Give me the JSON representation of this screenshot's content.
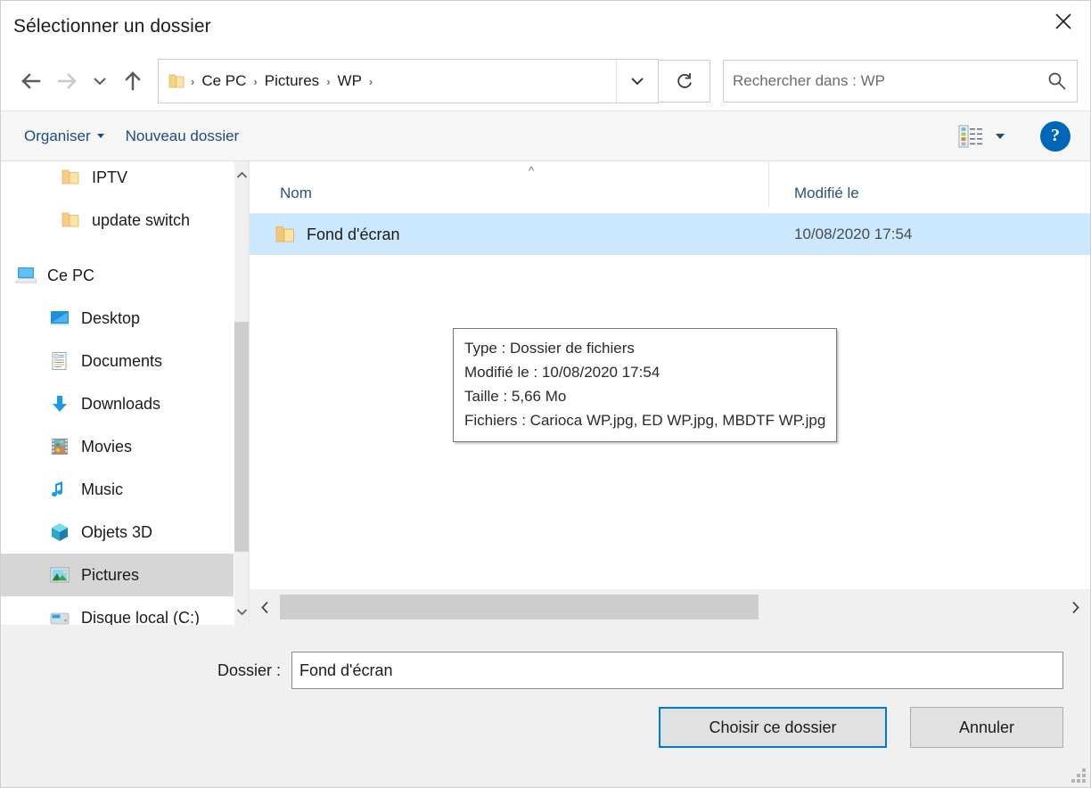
{
  "window": {
    "title": "Sélectionner un dossier",
    "close_label": "×",
    "close_icon": "close-icon"
  },
  "addressbar": {
    "back_icon": "arrow-left-icon",
    "forward_icon": "arrow-right-icon",
    "recent_icon": "chevron-down-icon",
    "up_icon": "arrow-up-icon",
    "folder_icon": "folder-icon",
    "crumb_separator": "›",
    "breadcrumbs": [
      {
        "label": "Ce PC"
      },
      {
        "label": "Pictures"
      },
      {
        "label": "WP"
      }
    ],
    "dropdown_icon": "chevron-down-icon",
    "refresh_icon": "refresh-icon",
    "refresh_label": "↻"
  },
  "search": {
    "value": "",
    "placeholder": "Rechercher dans : WP",
    "icon": "search-icon"
  },
  "toolbar": {
    "organize_label": "Organiser",
    "new_folder_label": "Nouveau dossier",
    "view_icon": "view-list-icon",
    "view_caret_icon": "chevron-down-icon",
    "help_label": "?",
    "help_icon": "help-icon"
  },
  "sidebar": {
    "items": [
      {
        "label": "IPTV",
        "icon": "folder-icon",
        "indent": 2,
        "selected": false
      },
      {
        "label": "update switch",
        "icon": "folder-icon",
        "indent": 2,
        "selected": false
      },
      {
        "label": "Ce PC",
        "icon": "this-pc-icon",
        "indent": 0,
        "selected": false
      },
      {
        "label": "Desktop",
        "icon": "desktop-icon",
        "indent": 1,
        "selected": false
      },
      {
        "label": "Documents",
        "icon": "documents-icon",
        "indent": 1,
        "selected": false
      },
      {
        "label": "Downloads",
        "icon": "downloads-icon",
        "indent": 1,
        "selected": false
      },
      {
        "label": "Movies",
        "icon": "movies-icon",
        "indent": 1,
        "selected": false
      },
      {
        "label": "Music",
        "icon": "music-icon",
        "indent": 1,
        "selected": false
      },
      {
        "label": "Objets 3D",
        "icon": "objects3d-icon",
        "indent": 1,
        "selected": false
      },
      {
        "label": "Pictures",
        "icon": "pictures-icon",
        "indent": 1,
        "selected": true
      },
      {
        "label": "Disque local (C:)",
        "icon": "disk-icon",
        "indent": 1,
        "selected": false
      }
    ],
    "scroll_up_icon": "chevron-up-icon",
    "scroll_down_icon": "chevron-down-icon"
  },
  "filelist": {
    "columns": [
      {
        "label": "Nom",
        "key": "name"
      },
      {
        "label": "Modifié le",
        "key": "date"
      }
    ],
    "sort_indicator": "^",
    "rows": [
      {
        "name": "Fond d'écran",
        "date": "10/08/2020 17:54",
        "icon": "folder-icon",
        "selected": true
      }
    ],
    "h_scroll_left_icon": "chevron-left-icon",
    "h_scroll_right_icon": "chevron-right-icon"
  },
  "tooltip": {
    "line_type": "Type : Dossier de fichiers",
    "line_modified": "Modifié le : 10/08/2020 17:54",
    "line_size": "Taille : 5,66 Mo",
    "line_files": "Fichiers : Carioca WP.jpg, ED WP.jpg, MBDTF WP.jpg"
  },
  "footer": {
    "folder_label": "Dossier :",
    "folder_value": "Fond d'écran",
    "folder_placeholder": "",
    "choose_label": "Choisir ce dossier",
    "cancel_label": "Annuler",
    "resize_grip_icon": "resize-grip-icon"
  },
  "colors": {
    "accent": "#0078d7",
    "selection": "#cce8ff",
    "nav_selection": "#d6d6d6",
    "link": "#1e4c7d",
    "help_blue": "#0067b8",
    "chrome_gray": "#f0f0f0",
    "toolbar_gray": "#f6f6f6"
  }
}
